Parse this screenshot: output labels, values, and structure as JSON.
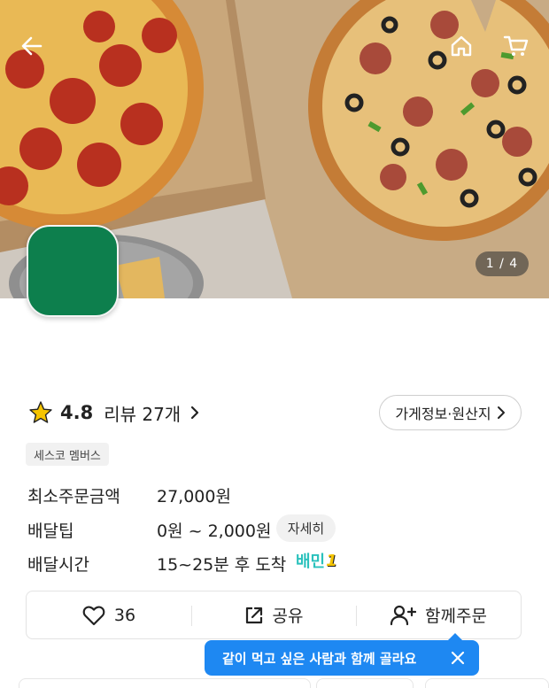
{
  "hero": {
    "image_counter": "1 / 4",
    "icons": {
      "back": "back-arrow-icon",
      "home": "home-icon",
      "cart": "cart-icon"
    }
  },
  "store": {
    "logo_color": "#0d7f4d",
    "rating": "4.8",
    "review_label": "리뷰 27개",
    "info_button": "가게정보·원산지",
    "badge": "세스코 멤버스"
  },
  "info": {
    "min_order_label": "최소주문금액",
    "min_order_value": "27,000원",
    "delivery_tip_label": "배달팁",
    "delivery_tip_value": "0원 ~ 2,000원",
    "detail_button": "자세히",
    "delivery_time_label": "배달시간",
    "delivery_time_value": "15~25분 후 도착",
    "service_badge": "배민",
    "service_badge_number": "1"
  },
  "actions": {
    "like_count": "36",
    "share_label": "공유",
    "group_order_label": "함께주문"
  },
  "tooltip": {
    "text": "같이 먹고 싶은 사람과 함께 골라요",
    "color": "#1e88f2"
  },
  "colors": {
    "accent_mint": "#2ac1bc",
    "star": "#f5c400"
  }
}
